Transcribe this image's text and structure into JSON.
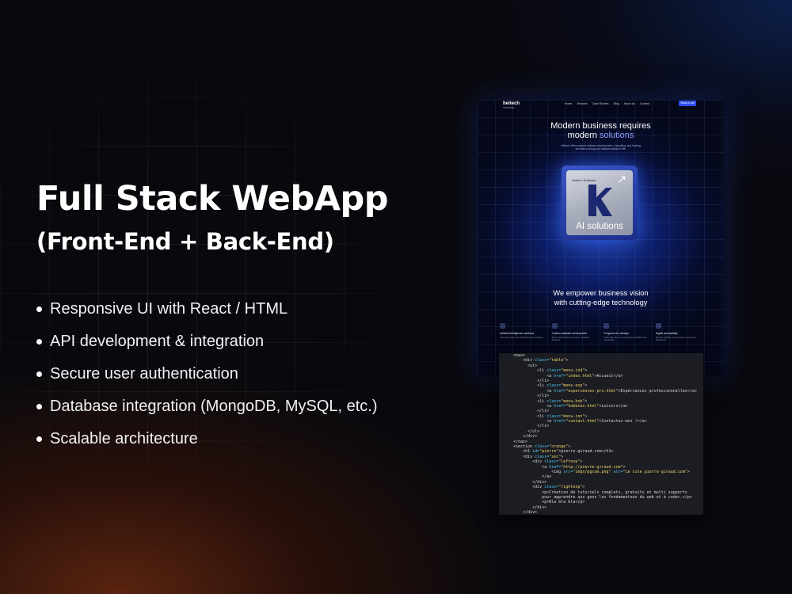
{
  "headline": "Full Stack WebApp",
  "subheadline": "(Front-End + Back-End)",
  "features": [
    "Responsive UI with React / HTML",
    "API development & integration",
    "Secure user authentication",
    "Database integration (MongoDB, MySQL, etc.)",
    "Scalable architecture"
  ],
  "colors": {
    "background": "#09090d",
    "accent_blue": "#2f4cf0",
    "glow_orange": "#5a2410"
  },
  "site_mockup": {
    "logo": "heitech",
    "logo_subtitle": "SOFTWARE",
    "nav_links": [
      "Home",
      "Services",
      "Case Studies",
      "Blog",
      "About Us",
      "Contact"
    ],
    "nav_cta": "Book a call",
    "hero_title_line1": "Modern business requires",
    "hero_title_line2_plain": "modern ",
    "hero_title_line2_accent": "solutions",
    "hero_description": "Heitech offers custom software development, consulting, and hosting services to bring your business ideas to life.",
    "card_brand": "Heitech Software",
    "card_label": "AI solutions",
    "mission_line1": "We empower business vision",
    "mission_line2": "with cutting-edge technology",
    "services": [
      {
        "title": "Artificial Intelligence solutions",
        "desc": "Automate tasks and streamline your business"
      },
      {
        "title": "Custom software development",
        "desc": "Boost productivity with custom software solutions"
      },
      {
        "title": "Programs for startups",
        "desc": "Scale fast with our expertise and reliable tech partnership"
      },
      {
        "title": "Digital accessibility",
        "desc": "Expand visibility, and increase conversions effortlessly"
      }
    ]
  },
  "code_lines": [
    [
      {
        "c": "tg",
        "t": "      <nav>"
      }
    ],
    [
      {
        "c": "tg",
        "t": "          <div "
      },
      {
        "c": "at",
        "t": "class="
      },
      {
        "c": "st",
        "t": "\"table\""
      },
      {
        "c": "tg",
        "t": ">"
      }
    ],
    [
      {
        "c": "tg",
        "t": "            <ul>"
      }
    ],
    [
      {
        "c": "tg",
        "t": "                <li "
      },
      {
        "c": "at",
        "t": "class="
      },
      {
        "c": "st",
        "t": "\"menu-ind\""
      },
      {
        "c": "tg",
        "t": ">"
      }
    ],
    [
      {
        "c": "tg",
        "t": "                    <a "
      },
      {
        "c": "at",
        "t": "href="
      },
      {
        "c": "st",
        "t": "\"index.html\""
      },
      {
        "c": "tg",
        "t": ">Accueil</a>"
      }
    ],
    [
      {
        "c": "tg",
        "t": "                </li>"
      }
    ],
    [
      {
        "c": "tg",
        "t": "                <li "
      },
      {
        "c": "at",
        "t": "class="
      },
      {
        "c": "st",
        "t": "\"menu-exp\""
      },
      {
        "c": "tg",
        "t": ">"
      }
    ],
    [
      {
        "c": "tg",
        "t": "                    <a "
      },
      {
        "c": "at",
        "t": "href="
      },
      {
        "c": "st",
        "t": "\"experiences-pro.html\""
      },
      {
        "c": "tg",
        "t": ">Expériences professionnelles</a>"
      }
    ],
    [
      {
        "c": "tg",
        "t": "                </li>"
      }
    ],
    [
      {
        "c": "tg",
        "t": "                <li "
      },
      {
        "c": "at",
        "t": "class="
      },
      {
        "c": "st",
        "t": "\"menu-hob\""
      },
      {
        "c": "tg",
        "t": ">"
      }
    ],
    [
      {
        "c": "tg",
        "t": "                    <a "
      },
      {
        "c": "at",
        "t": "href="
      },
      {
        "c": "st",
        "t": "\"hobbies.html\""
      },
      {
        "c": "tg",
        "t": ">Loisirs</a>"
      }
    ],
    [
      {
        "c": "tg",
        "t": "                </li>"
      }
    ],
    [
      {
        "c": "tg",
        "t": "                <li "
      },
      {
        "c": "at",
        "t": "class="
      },
      {
        "c": "st",
        "t": "\"menu-con\""
      },
      {
        "c": "tg",
        "t": ">"
      }
    ],
    [
      {
        "c": "tg",
        "t": "                    <a "
      },
      {
        "c": "at",
        "t": "href="
      },
      {
        "c": "st",
        "t": "\"contact.html\""
      },
      {
        "c": "tg",
        "t": ">Contactez-moi !</a>"
      }
    ],
    [
      {
        "c": "tg",
        "t": "                </li>"
      }
    ],
    [
      {
        "c": "tg",
        "t": "            </ul>"
      }
    ],
    [
      {
        "c": "tg",
        "t": "          </div>"
      }
    ],
    [
      {
        "c": "tg",
        "t": "      </nav>"
      }
    ],
    [
      {
        "c": "tg",
        "t": "      <section "
      },
      {
        "c": "at",
        "t": "class="
      },
      {
        "c": "st",
        "t": "\"orange\""
      },
      {
        "c": "tg",
        "t": ">"
      }
    ],
    [
      {
        "c": "tg",
        "t": "          <h1 "
      },
      {
        "c": "at",
        "t": "id="
      },
      {
        "c": "st",
        "t": "\"pierre\""
      },
      {
        "c": "tg",
        "t": ">pierre-giraud.com</h1>"
      }
    ],
    [
      {
        "c": "tg",
        "t": "          <div "
      },
      {
        "c": "at",
        "t": "class="
      },
      {
        "c": "st",
        "t": "\"sec\""
      },
      {
        "c": "tg",
        "t": ">"
      }
    ],
    [
      {
        "c": "tg",
        "t": "              <div "
      },
      {
        "c": "at",
        "t": "class="
      },
      {
        "c": "st",
        "t": "\"leftexp\""
      },
      {
        "c": "tg",
        "t": ">"
      }
    ],
    [
      {
        "c": "tg",
        "t": "                  <a "
      },
      {
        "c": "at",
        "t": "href="
      },
      {
        "c": "st",
        "t": "\"http://pierre-giraud.com\""
      },
      {
        "c": "tg",
        "t": ">"
      }
    ],
    [
      {
        "c": "tg",
        "t": "                      <img "
      },
      {
        "c": "at",
        "t": "src="
      },
      {
        "c": "st",
        "t": "\"imgs/pgcom.png\""
      },
      {
        "c": "tg",
        "t": " "
      },
      {
        "c": "at",
        "t": "alt="
      },
      {
        "c": "st",
        "t": "\"Le site pierre-giraud.com\""
      },
      {
        "c": "tg",
        "t": ">"
      }
    ],
    [
      {
        "c": "tg",
        "t": "                  </a>"
      }
    ],
    [
      {
        "c": "tg",
        "t": "              </div>"
      }
    ],
    [
      {
        "c": "tg",
        "t": "              <div "
      },
      {
        "c": "at",
        "t": "class="
      },
      {
        "c": "st",
        "t": "\"rightexp\""
      },
      {
        "c": "tg",
        "t": ">"
      }
    ],
    [
      {
        "c": "tg",
        "t": "                  <p>Création de tutoriels complets, gratuits et multi supports"
      }
    ],
    [
      {
        "c": "tg",
        "t": "                  pour apprendre aux gens les fondamentaux du web et à coder.</p>"
      }
    ],
    [
      {
        "c": "tg",
        "t": "                  <p>Bla bla bla</p>"
      }
    ],
    [
      {
        "c": "tg",
        "t": "              </div>"
      }
    ],
    [
      {
        "c": "tg",
        "t": "          </div>"
      }
    ]
  ]
}
